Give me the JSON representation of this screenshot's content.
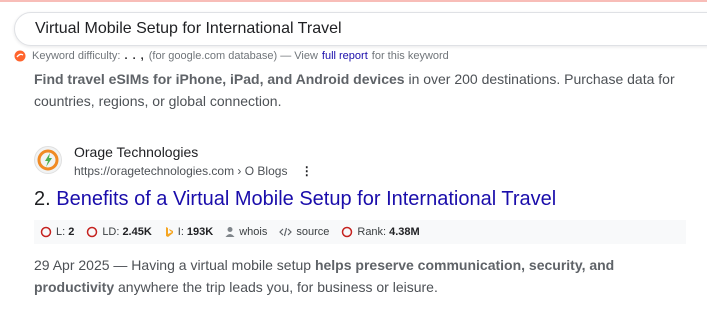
{
  "search": {
    "query": "Virtual Mobile Setup for International Travel"
  },
  "keyword_bar": {
    "label": "Keyword difficulty:",
    "value": ". . ,",
    "db_note": "(for google.com database) — View",
    "link": "full report",
    "suffix": "for this keyword"
  },
  "prev_result": {
    "snippet_bold": "Find travel eSIMs for iPhone, iPad, and Android devices",
    "snippet_rest": " in over 200 destinations. Purchase data for countries, regions, or global connection."
  },
  "result": {
    "site_name": "Orage Technologies",
    "url": "https://oragetechnologies.com › O Blogs",
    "number": "2.",
    "title": "Benefits of a Virtual Mobile Setup for International Travel",
    "metrics": {
      "l_label": "L:",
      "l_value": "2",
      "ld_label": "LD:",
      "ld_value": "2.45K",
      "i_label": "I:",
      "i_value": "193K",
      "whois": "whois",
      "source": "source",
      "rank_label": "Rank:",
      "rank_value": "4.38M"
    },
    "date": "29 Apr 2025",
    "snippet_a": " — Having a virtual mobile setup ",
    "snippet_b": "helps preserve communication, security, and productivity",
    "snippet_c": " anywhere the trip leads you, for business or leisure."
  },
  "colors": {
    "link": "#1a0dab",
    "metric_icon": "#c5221f",
    "bing_icon": "#f5a623"
  }
}
